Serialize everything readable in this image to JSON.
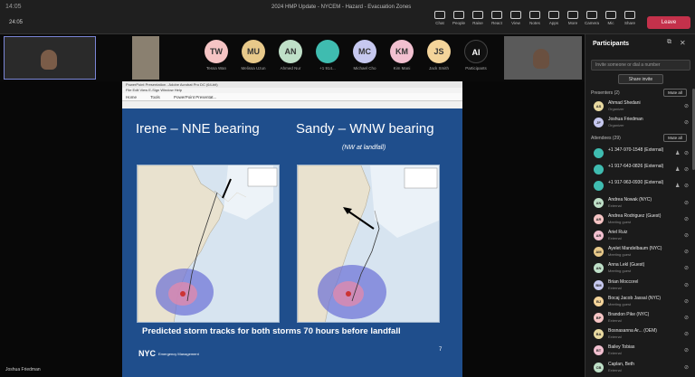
{
  "window": {
    "title": "2024 HMP Update - NYCEM - Hazard - Evacuation Zones",
    "clock": "14:05",
    "meeting_timer": "24:05"
  },
  "toolbar": {
    "buttons": [
      {
        "label": "Chat",
        "icon": "chat-icon"
      },
      {
        "label": "People",
        "icon": "people-icon"
      },
      {
        "label": "Raise",
        "icon": "hand-icon"
      },
      {
        "label": "React",
        "icon": "smile-icon"
      },
      {
        "label": "View",
        "icon": "grid-icon"
      },
      {
        "label": "Notes",
        "icon": "notes-icon"
      },
      {
        "label": "Apps",
        "icon": "apps-icon"
      },
      {
        "label": "More",
        "icon": "more-icon"
      },
      {
        "label": "Camera",
        "icon": "camera-icon"
      },
      {
        "label": "Mic",
        "icon": "mic-icon"
      },
      {
        "label": "Share",
        "icon": "share-icon"
      }
    ],
    "leave_label": "Leave"
  },
  "gallery": {
    "avatars": [
      {
        "initials": "TW",
        "name": "Tessa Wan",
        "color": "#f5c4c4"
      },
      {
        "initials": "MU",
        "name": "Melissa Uzun",
        "color": "#e8c98a"
      },
      {
        "initials": "AN",
        "name": "Ahmed Nur",
        "color": "#bfe0c8"
      },
      {
        "initials": "",
        "name": "+1 914...",
        "color": "#3fbcb0"
      },
      {
        "initials": "MC",
        "name": "Michael Cho",
        "color": "#c6c8ef"
      },
      {
        "initials": "KM",
        "name": "Kim Mani",
        "color": "#f2c0d0"
      },
      {
        "initials": "JS",
        "name": "Jack Smith",
        "color": "#f4d49a"
      },
      {
        "initials": "AI",
        "name": "Participants",
        "color": "#111111"
      }
    ],
    "speaker_name": "Joshua Friedman"
  },
  "share_window": {
    "title": "PowerPoint Presentation - Adobe Acrobat Pro DC (64-bit)",
    "menu": "File  Edit  View  E-Sign  Window  Help",
    "tabs": [
      "Home",
      "Tools",
      "PowerPoint Presentat..."
    ]
  },
  "slide": {
    "left_heading": "Irene – NNE bearing",
    "right_heading": "Sandy – WNW bearing",
    "right_subheading": "(NW at landfall)",
    "caption": "Predicted storm tracks for both storms 70 hours before landfall",
    "logo_text": "NYC",
    "logo_sub": "Emergency Management",
    "page_number": "7"
  },
  "participants": {
    "title": "Participants",
    "search_placeholder": "Invite someone or dial a number",
    "share_invite": "Share invite",
    "presenters_label": "Presenters (2)",
    "attendees_label": "Attendees (29)",
    "mute_all": "Mute all",
    "presenters": [
      {
        "initials": "AS",
        "name": "Ahmad Shedani",
        "role": "Organizer",
        "color": "#e8d9a0"
      },
      {
        "initials": "JF",
        "name": "Joshua Friedman",
        "role": "Organizer",
        "color": "#c6c8ef"
      }
    ],
    "attendees": [
      {
        "initials": "",
        "name": "+1 347-970-1548 (External)",
        "role": "",
        "color": "#3fbcb0"
      },
      {
        "initials": "",
        "name": "+1 917-643-0826 (External)",
        "role": "",
        "color": "#3fbcb0"
      },
      {
        "initials": "",
        "name": "+1 917-963-0930 (External)",
        "role": "",
        "color": "#3fbcb0"
      },
      {
        "initials": "AN",
        "name": "Andrea Nowak (NYC)",
        "role": "External",
        "color": "#bfe0c8"
      },
      {
        "initials": "AR",
        "name": "Andrea Rodriguez (Guest)",
        "role": "Meeting guest",
        "color": "#f5c4c4"
      },
      {
        "initials": "AR",
        "name": "Ariel Ruiz",
        "role": "External",
        "color": "#f2c0d0"
      },
      {
        "initials": "AM",
        "name": "Ayelet Mandelbaum (NYC)",
        "role": "Meeting guest",
        "color": "#e8c98a"
      },
      {
        "initials": "AN",
        "name": "Anna Lekl (Guest)",
        "role": "Meeting guest",
        "color": "#bfe0c8"
      },
      {
        "initials": "BM",
        "name": "Brian Moccorel",
        "role": "External",
        "color": "#c6c8ef"
      },
      {
        "initials": "BJ",
        "name": "Bocaj Jacob Jassal (NYC)",
        "role": "Meeting guest",
        "color": "#f4d49a"
      },
      {
        "initials": "BP",
        "name": "Brandon Pike (NYC)",
        "role": "External",
        "color": "#f5c4c4"
      },
      {
        "initials": "BA",
        "name": "Bosnasanna Ar... (OEM)",
        "role": "External",
        "color": "#e8d9a0"
      },
      {
        "initials": "BT",
        "name": "Bailey Tobias",
        "role": "External",
        "color": "#f2c0d0"
      },
      {
        "initials": "CB",
        "name": "Caplan, Beth",
        "role": "External",
        "color": "#bfe0c8"
      }
    ]
  }
}
